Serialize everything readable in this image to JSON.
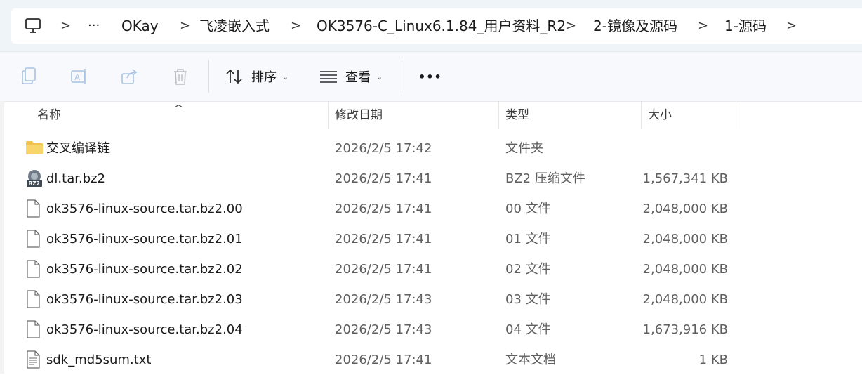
{
  "breadcrumb": {
    "items": [
      "OKay",
      "飞凌嵌入式",
      "OK3576-C_Linux6.1.84_用户资料_R2",
      "2-镜像及源码",
      "1-源码"
    ],
    "more": "···",
    "separator": ">"
  },
  "toolbar": {
    "sort_label": "排序",
    "view_label": "查看",
    "more_label": "•••"
  },
  "columns": {
    "name": "名称",
    "date": "修改日期",
    "type": "类型",
    "size": "大小",
    "sort_indicator": "^"
  },
  "files": [
    {
      "name": "交叉编译链",
      "date": "2026/2/5 17:42",
      "type": "文件夹",
      "size": "",
      "icon": "folder-icon"
    },
    {
      "name": "dl.tar.bz2",
      "date": "2026/2/5 17:41",
      "type": "BZ2 压缩文件",
      "size": "1,567,341 KB",
      "icon": "bz2-archive-icon"
    },
    {
      "name": "ok3576-linux-source.tar.bz2.00",
      "date": "2026/2/5 17:41",
      "type": "00 文件",
      "size": "2,048,000 KB",
      "icon": "file-icon"
    },
    {
      "name": "ok3576-linux-source.tar.bz2.01",
      "date": "2026/2/5 17:41",
      "type": "01 文件",
      "size": "2,048,000 KB",
      "icon": "file-icon"
    },
    {
      "name": "ok3576-linux-source.tar.bz2.02",
      "date": "2026/2/5 17:41",
      "type": "02 文件",
      "size": "2,048,000 KB",
      "icon": "file-icon"
    },
    {
      "name": "ok3576-linux-source.tar.bz2.03",
      "date": "2026/2/5 17:43",
      "type": "03 文件",
      "size": "2,048,000 KB",
      "icon": "file-icon"
    },
    {
      "name": "ok3576-linux-source.tar.bz2.04",
      "date": "2026/2/5 17:43",
      "type": "04 文件",
      "size": "1,673,916 KB",
      "icon": "file-icon"
    },
    {
      "name": "sdk_md5sum.txt",
      "date": "2026/2/5 17:41",
      "type": "文本文档",
      "size": "1 KB",
      "icon": "text-file-icon"
    }
  ]
}
